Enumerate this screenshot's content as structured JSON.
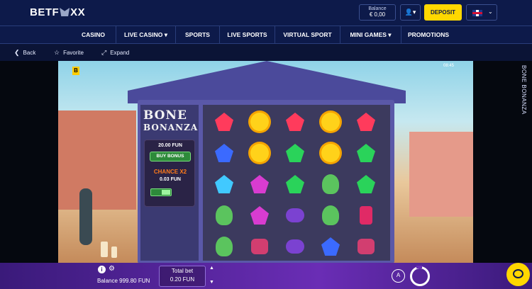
{
  "brand": {
    "prefix": "BETF",
    "suffix": "XX"
  },
  "header": {
    "balance_label": "Balance",
    "balance_value": "€ 0,00",
    "user_icon": "user-icon",
    "deposit_label": "DEPOSIT",
    "language_icon": "uk-flag-icon"
  },
  "nav": {
    "items": [
      {
        "label": "CASINO"
      },
      {
        "label": "LIVE CASINO ▾"
      },
      {
        "label": "SPORTS"
      },
      {
        "label": "LIVE SPORTS"
      },
      {
        "label": "VIRTUAL SPORT"
      },
      {
        "label": "MINI GAMES ▾"
      },
      {
        "label": "PROMOTIONS"
      }
    ]
  },
  "toolbar": {
    "back": "Back",
    "favorite": "Favorite",
    "expand": "Expand"
  },
  "game": {
    "side_title": "BONE BONANZA",
    "logo_line1": "BONE",
    "logo_line2": "BONANZA",
    "bet_amount": "20.00 FUN",
    "buy_bonus": "BUY BONUS",
    "chance": "CHANCE X2",
    "chance_amount": "0.03 FUN",
    "clock": "08:45",
    "badge": "B",
    "grid": [
      [
        "red-gem",
        "sun",
        "red-gem",
        "sun",
        "red-gem"
      ],
      [
        "blue-gem",
        "sun",
        "green-gem",
        "sun",
        "green-gem"
      ],
      [
        "teal-gem",
        "pink-gem",
        "green-gem",
        "skull",
        "green-gem"
      ],
      [
        "skull",
        "pink-gem",
        "grapes",
        "skull",
        "potion"
      ],
      [
        "skull",
        "mustache",
        "grapes",
        "blue-gem",
        "mustache"
      ]
    ]
  },
  "footer": {
    "balance_text": "Balance 999.80 FUN",
    "total_bet_label": "Total bet",
    "total_bet_value": "0.20 FUN",
    "auto_label": "A"
  },
  "colors": {
    "nav_bg": "#0d1a4a",
    "deposit": "#ffd700",
    "footer": "#6a2db5"
  }
}
